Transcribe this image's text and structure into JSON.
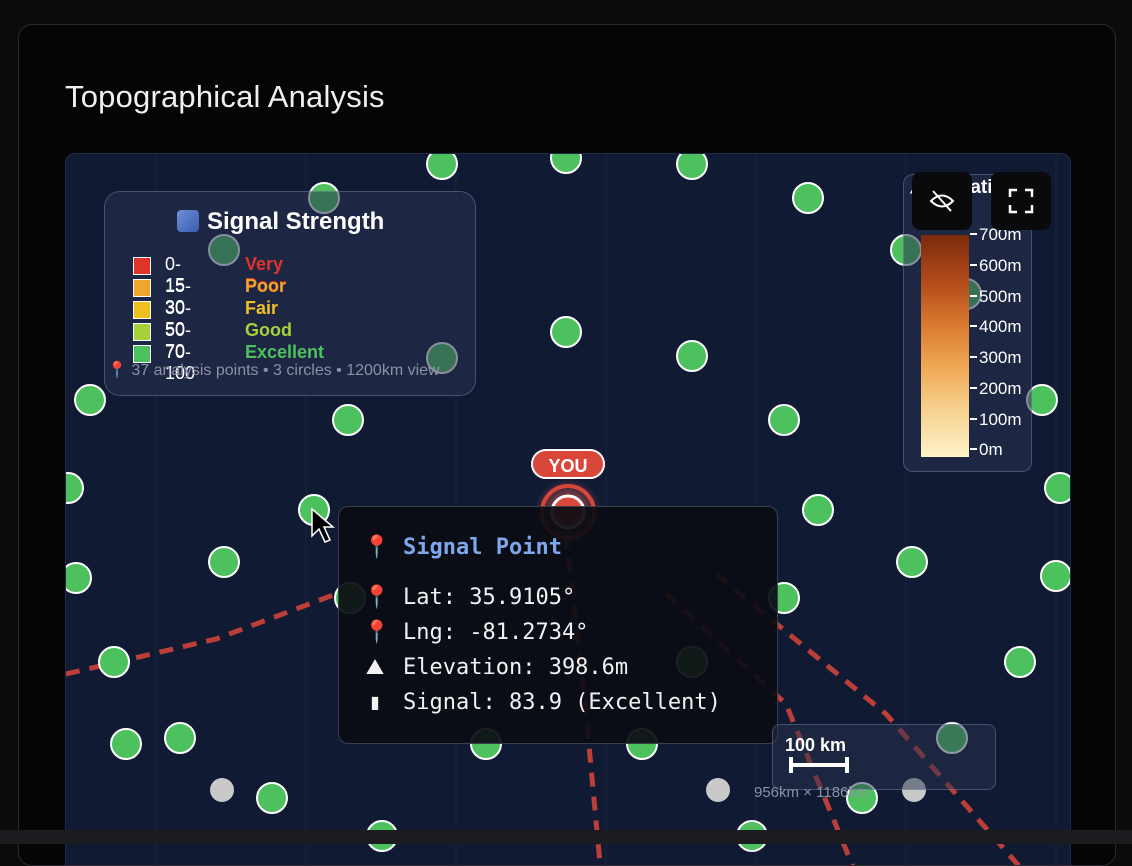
{
  "panel": {
    "title": "Topographical Analysis"
  },
  "legend": {
    "title": "Signal Strength",
    "rows": [
      {
        "range": "0-15",
        "label": "Very Poor",
        "color": "#e0342b"
      },
      {
        "range": "15-30",
        "label": "Poor",
        "color": "#f0a52c"
      },
      {
        "range": "30-50",
        "label": "Fair",
        "color": "#f0c020"
      },
      {
        "range": "50-70",
        "label": "Good",
        "color": "#a7d13a"
      },
      {
        "range": "70-100",
        "label": "Excellent",
        "color": "#4cc15e"
      }
    ],
    "footer": "📍 37 analysis points • 3 circles • 1200km view"
  },
  "elevation": {
    "title": "Elevation",
    "ticks": [
      "700m",
      "600m",
      "500m",
      "400m",
      "300m",
      "200m",
      "100m",
      "0m"
    ]
  },
  "map": {
    "you_label": "YOU",
    "colors": {
      "point": "#4cc15e",
      "route": "#d9463a",
      "background": "#111a33"
    }
  },
  "tooltip": {
    "title": "Signal Point",
    "lat": "Lat: 35.9105°",
    "lng": "Lng: -81.2734°",
    "elevation": "Elevation: 398.6m",
    "signal": "Signal: 83.9 (Excellent)"
  },
  "scale": {
    "label": "100 km",
    "extent": "956km × 1186km"
  },
  "icons": [
    "signal-bars-icon",
    "pin-icon",
    "mountain-icon",
    "hide-eye-icon",
    "fullscreen-icon",
    "cursor-icon",
    "satellite-icon"
  ]
}
